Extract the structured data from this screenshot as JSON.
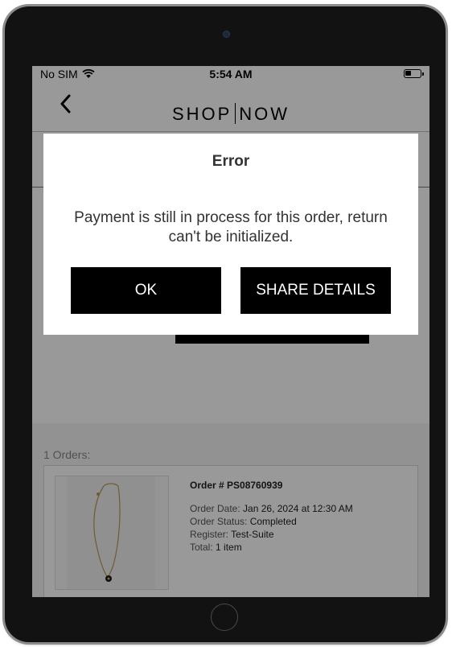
{
  "status_bar": {
    "carrier": "No SIM",
    "time": "5:54 AM",
    "wifi_icon": "wifi-icon",
    "battery_icon": "battery-icon"
  },
  "nav": {
    "back_icon": "chevron-left-icon",
    "brand_left": "SHOP",
    "brand_right": "NOW"
  },
  "orders": {
    "count_label": "1 Orders:",
    "items": [
      {
        "order_number": "Order # PS08760939",
        "order_date_label": "Order Date:",
        "order_date": " Jan 26, 2024 at 12:30 AM",
        "order_status_label": "Order Status:",
        "order_status": " Completed",
        "register_label": "Register:",
        "register": " Test-Suite",
        "total_label": "Total:",
        "total": " 1 item"
      }
    ]
  },
  "dialog": {
    "title": "Error",
    "message": "Payment is still in process for this order, return can't be initialized.",
    "ok_label": "OK",
    "share_label": "SHARE DETAILS"
  },
  "colors": {
    "overlay": "rgba(0,0,0,0.4)",
    "button_bg": "#000000",
    "button_text": "#ffffff"
  }
}
